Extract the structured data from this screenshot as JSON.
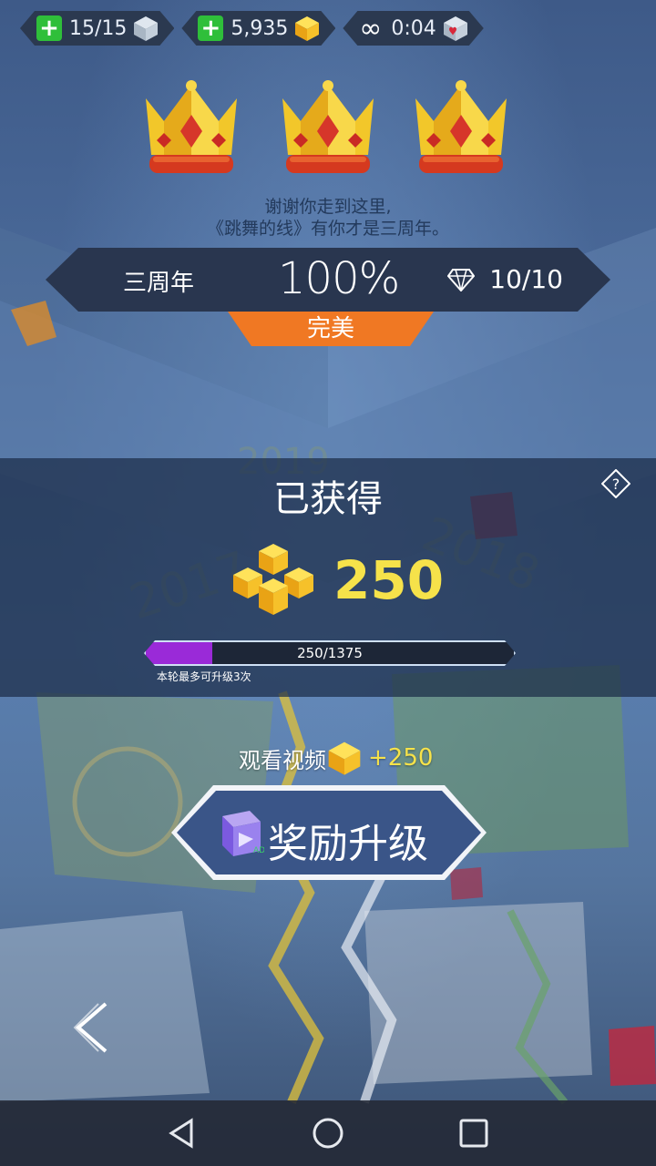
{
  "top_bar": {
    "lives": "15/15",
    "coins": "5,935",
    "timer": "0:04"
  },
  "thanks_line1": "谢谢你走到这里,",
  "thanks_line2": "《跳舞的线》有你才是三周年。",
  "result": {
    "level_name": "三周年",
    "percent": "100%",
    "gems": "10/10",
    "rating": "完美"
  },
  "earned": {
    "title": "已获得",
    "reward_value": "250",
    "progress_text": "250/1375",
    "progress_fraction": 0.1818,
    "upgrade_note": "本轮最多可升级3次"
  },
  "watch_video": {
    "label": "观看视频",
    "bonus": "+250"
  },
  "upgrade_button": {
    "label": "奖励升级",
    "badge": "AD"
  },
  "colors": {
    "accent_orange": "#f07823",
    "progress_purple": "#9a2ad8",
    "gold_text": "#f6e24a",
    "panel_dark": "#29364f"
  },
  "icons": [
    "plus-icon",
    "cube-icon",
    "gold-cube-icon",
    "infinity-icon",
    "heart-cube-icon",
    "crown-icon",
    "diamond-icon",
    "help-icon",
    "ad-video-icon",
    "back-chevron-icon",
    "nav-back-icon",
    "nav-home-icon",
    "nav-recents-icon"
  ]
}
